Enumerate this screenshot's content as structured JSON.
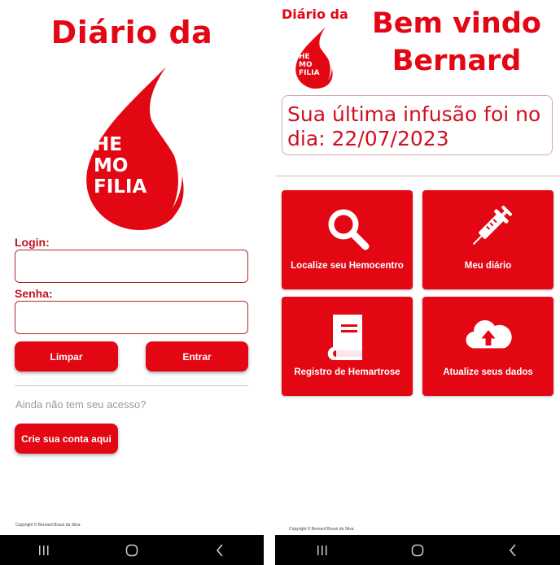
{
  "colors": {
    "brand_red": "#e30613",
    "nav_bar": "#000000",
    "muted_text": "#9a9a9a"
  },
  "login": {
    "title": "Diário da",
    "logo_lines": [
      "HE",
      "MO",
      "FILIA"
    ],
    "login_label": "Login:",
    "login_value": "",
    "password_label": "Senha:",
    "password_value": "",
    "clear_button": "Limpar",
    "enter_button": "Entrar",
    "no_access_text": "Ainda não tem seu acesso?",
    "create_account_button": "Crie sua conta aqui",
    "copyright": "Copyright © Bernard Braun da Silva"
  },
  "home": {
    "brand_title": "Diário da",
    "logo_lines": [
      "HE",
      "MO",
      "FILIA"
    ],
    "welcome_line1": "Bem vindo",
    "welcome_line2": "Bernard",
    "last_infusion": "Sua última infusão foi no dia: 22/07/2023",
    "tiles": [
      {
        "label": "Localize seu Hemocentro",
        "icon": "search-icon"
      },
      {
        "label": "Meu diário",
        "icon": "syringe-icon"
      },
      {
        "label": "Registro de Hemartrose",
        "icon": "book-icon"
      },
      {
        "label": "Atualize seus dados",
        "icon": "cloud-upload-icon"
      }
    ],
    "copyright": "Copyright © Bernard Braun da Silva"
  },
  "navbar": {
    "icons": [
      "recent-apps-icon",
      "home-icon",
      "back-icon"
    ]
  }
}
